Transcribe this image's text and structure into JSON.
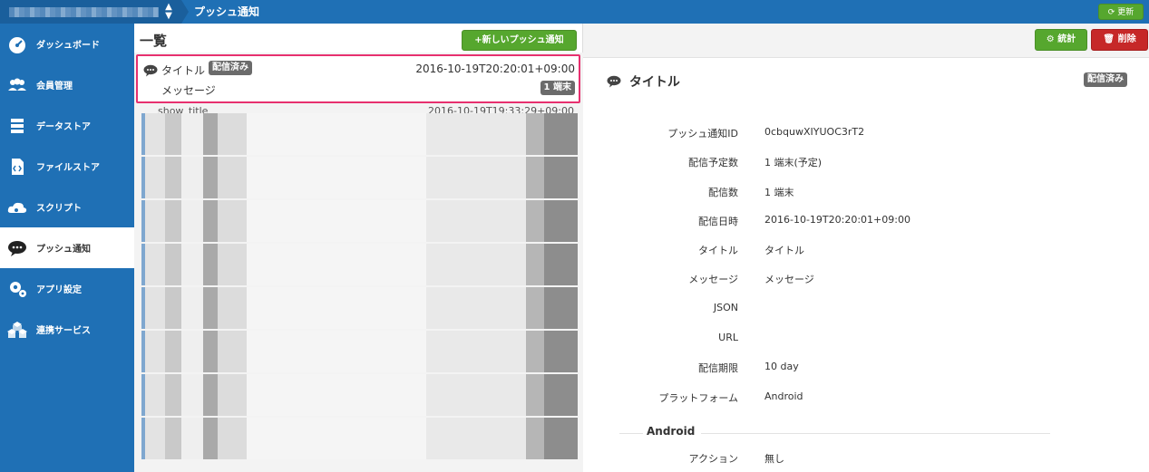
{
  "header": {
    "page_title": "プッシュ通知",
    "refresh_label": "更新"
  },
  "sidebar": {
    "items": [
      {
        "label": "ダッシュボード",
        "icon": "dashboard-icon"
      },
      {
        "label": "会員管理",
        "icon": "users-icon"
      },
      {
        "label": "データストア",
        "icon": "datastore-icon"
      },
      {
        "label": "ファイルストア",
        "icon": "file-code-icon"
      },
      {
        "label": "スクリプト",
        "icon": "cloud-gear-icon"
      },
      {
        "label": "プッシュ通知",
        "icon": "chat-bubble-icon",
        "active": true
      },
      {
        "label": "アプリ設定",
        "icon": "gears-icon"
      },
      {
        "label": "連携サービス",
        "icon": "cubes-icon"
      }
    ]
  },
  "list": {
    "title": "一覧",
    "new_button": "+新しいプッシュ通知",
    "selected": {
      "title": "タイトル",
      "status": "配信済み",
      "date": "2016-10-19T20:20:01+09:00",
      "message": "メッセージ",
      "count": "1 端末"
    },
    "partial_row": {
      "title": "show_title",
      "date": "2016-10-19T19:33:29+09:00"
    }
  },
  "detail": {
    "stats_button": "統計",
    "delete_button": "削除",
    "heading": "タイトル",
    "status": "配信済み",
    "fields": [
      {
        "label": "プッシュ通知ID",
        "value": "0cbquwXIYUOC3rT2"
      },
      {
        "label": "配信予定数",
        "value": "1 端末(予定)"
      },
      {
        "label": "配信数",
        "value": "1 端末"
      },
      {
        "label": "配信日時",
        "value": "2016-10-19T20:20:01+09:00"
      },
      {
        "label": "タイトル",
        "value": "タイトル"
      },
      {
        "label": "メッセージ",
        "value": "メッセージ"
      },
      {
        "label": "JSON",
        "value": ""
      },
      {
        "label": "URL",
        "value": ""
      },
      {
        "label": "配信期限",
        "value": "10 day"
      },
      {
        "label": "プラットフォーム",
        "value": "Android"
      }
    ],
    "android_section": {
      "title": "Android",
      "fields": [
        {
          "label": "アクション",
          "value": "無し"
        }
      ]
    }
  },
  "colors": {
    "brand_blue": "#1f70b5",
    "green": "#56a72e",
    "red": "#c62828",
    "highlight": "#e7306f"
  }
}
